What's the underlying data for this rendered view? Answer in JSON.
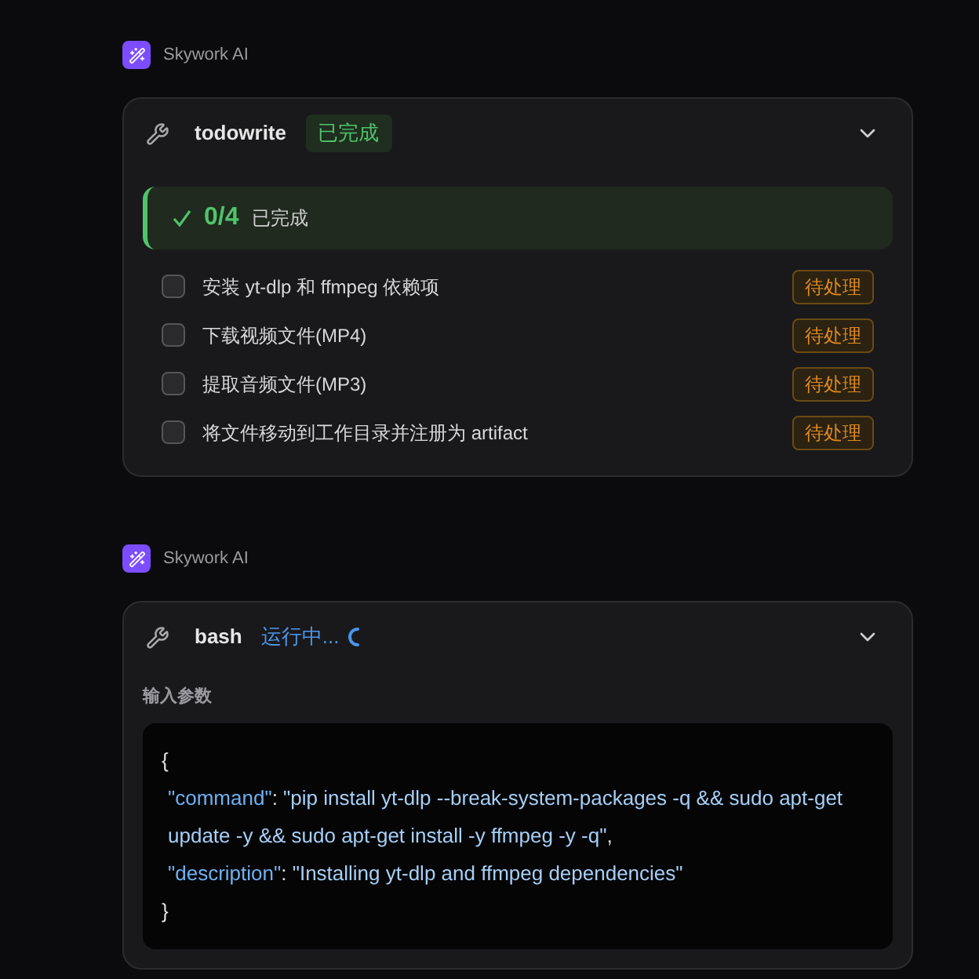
{
  "messages": [
    {
      "sender": "Skywork AI",
      "tool": {
        "name": "todowrite",
        "status": {
          "kind": "done",
          "label": "已完成"
        },
        "expanded": true,
        "progress": {
          "count": "0/4",
          "label": "已完成"
        },
        "tasks": [
          {
            "label": "安装 yt-dlp 和 ffmpeg 依赖项",
            "checked": false,
            "status": "待处理"
          },
          {
            "label": "下载视频文件(MP4)",
            "checked": false,
            "status": "待处理"
          },
          {
            "label": "提取音频文件(MP3)",
            "checked": false,
            "status": "待处理"
          },
          {
            "label": "将文件移动到工作目录并注册为 artifact",
            "checked": false,
            "status": "待处理"
          }
        ]
      }
    },
    {
      "sender": "Skywork AI",
      "tool": {
        "name": "bash",
        "status": {
          "kind": "running",
          "label": "运行中..."
        },
        "expanded": true,
        "input_label": "输入参数",
        "code": {
          "open": "{",
          "close": "}",
          "entries": [
            {
              "key": "\"command\"",
              "sep": ": ",
              "value": "\"pip install yt-dlp --break-system-packages -q && sudo apt-get update -y && sudo apt-get install -y ffmpeg -y -q\"",
              "trail": ","
            },
            {
              "key": "\"description\"",
              "sep": ": ",
              "value": "\"Installing yt-dlp and ffmpeg dependencies\""
            }
          ]
        }
      }
    }
  ]
}
